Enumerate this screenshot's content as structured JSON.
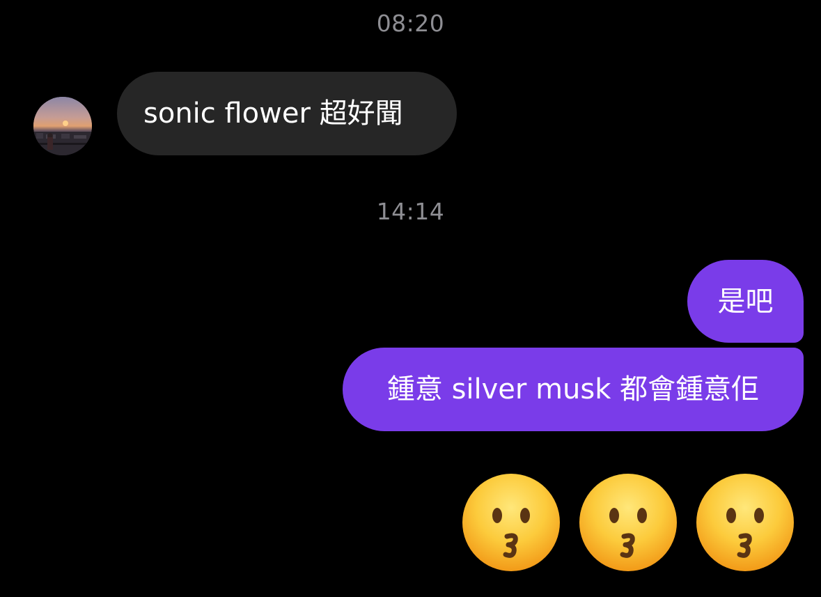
{
  "timestamps": [
    "08:20",
    "14:14"
  ],
  "messages": {
    "incoming_1": "sonic flower 超好聞",
    "outgoing_1": "是吧",
    "outgoing_2": "鍾意 silver musk 都會鍾意佢"
  },
  "emoji": {
    "name": "kissing-face-icon",
    "count": 3
  },
  "colors": {
    "background": "#000000",
    "incoming_bubble": "#262626",
    "outgoing_bubble": "#7a3ce9",
    "timestamp": "#8e8e93",
    "text": "#ffffff"
  }
}
